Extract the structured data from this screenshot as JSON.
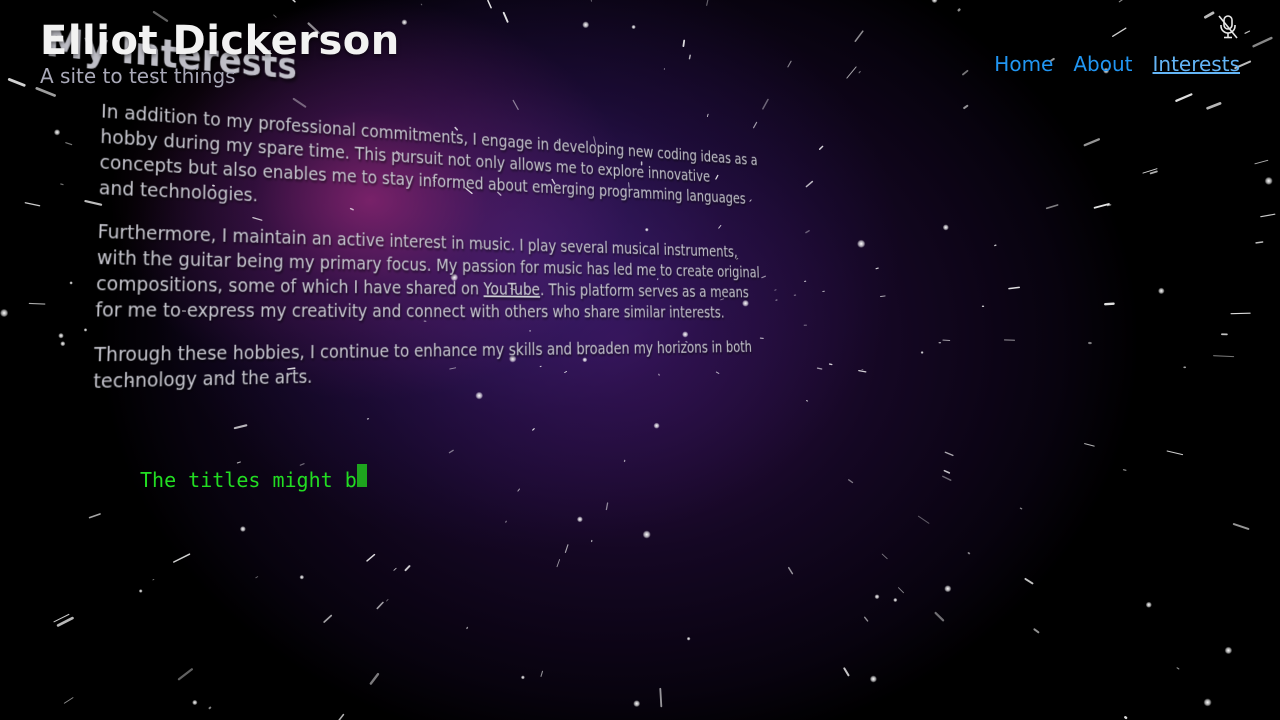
{
  "header": {
    "site_title": "Elliot Dickerson",
    "tagline": "A site to test things"
  },
  "nav": {
    "items": [
      {
        "label": "Home",
        "active": false
      },
      {
        "label": "About",
        "active": false
      },
      {
        "label": "Interests",
        "active": true
      }
    ]
  },
  "toolbar": {
    "mic_icon": "microphone-muted-icon"
  },
  "content": {
    "heading": "My Interests",
    "paragraph_1": "In addition to my professional commitments, I engage in developing new coding ideas as a hobby during my spare time. This pursuit not only allows me to explore innovative concepts but also enables me to stay informed about emerging programming languages and technologies.",
    "paragraph_2_before": "Furthermore, I maintain an active interest in music. I play several musical instruments, with the guitar being my primary focus. My passion for music has led me to create original compositions, some of which I have shared on ",
    "paragraph_2_link": "YouTube",
    "paragraph_2_after": ". This platform serves as a means for me to express my creativity and connect with others who share similar interests.",
    "paragraph_3": "Through these hobbies, I continue to enhance my skills and broaden my horizons in both technology and the arts."
  },
  "terminal": {
    "typed_text": "The titles might b"
  },
  "colors": {
    "nav_link": "#2196f3",
    "nav_active": "#64b5f6",
    "terminal_text": "#22dd22",
    "cursor": "#1ea51e",
    "nebula_purple": "#3c145a",
    "nebula_pink": "#962878"
  }
}
